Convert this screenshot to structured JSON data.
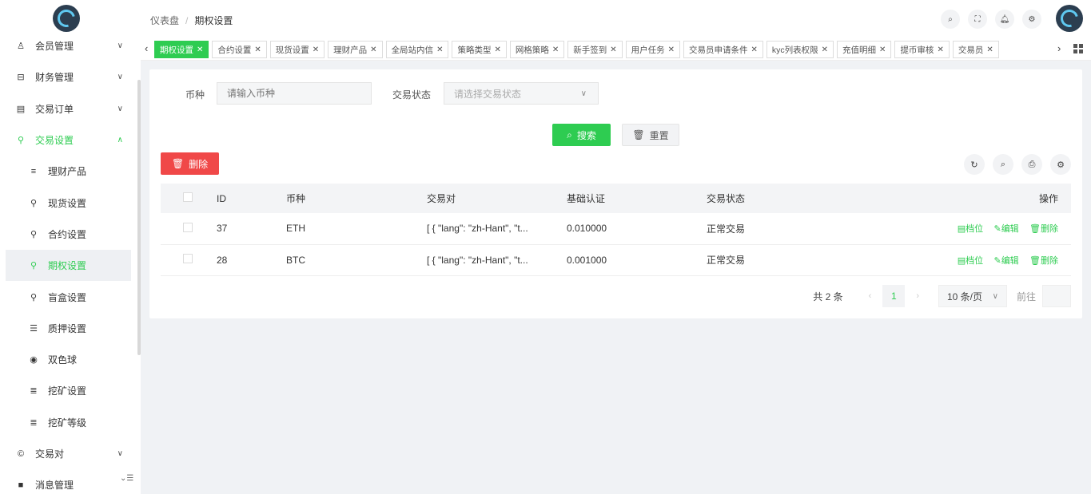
{
  "header": {
    "breadcrumb": [
      "仪表盘",
      "期权设置"
    ],
    "icons": [
      "search-icon",
      "fullscreen-icon",
      "bell-icon",
      "settings-icon"
    ]
  },
  "sidebar": {
    "items": [
      {
        "label": "会员管理",
        "icon": "user-icon",
        "chevron": "v"
      },
      {
        "label": "财务管理",
        "icon": "wallet-icon",
        "chevron": "v"
      },
      {
        "label": "交易订单",
        "icon": "order-icon",
        "chevron": "v"
      },
      {
        "label": "交易设置",
        "icon": "wrench-icon",
        "chevron": "^"
      },
      {
        "label": "理财产品",
        "icon": "list-icon"
      },
      {
        "label": "现货设置",
        "icon": "wrench-icon"
      },
      {
        "label": "合约设置",
        "icon": "wrench-icon"
      },
      {
        "label": "期权设置",
        "icon": "wrench-icon"
      },
      {
        "label": "盲盒设置",
        "icon": "wrench-icon"
      },
      {
        "label": "质押设置",
        "icon": "lines-icon"
      },
      {
        "label": "双色球",
        "icon": "target-icon"
      },
      {
        "label": "挖矿设置",
        "icon": "stack-icon"
      },
      {
        "label": "挖矿等级",
        "icon": "stack-icon"
      },
      {
        "label": "交易对",
        "icon": "copyright-icon",
        "chevron": "v"
      },
      {
        "label": "消息管理",
        "icon": "message-icon",
        "chevron": "v"
      }
    ]
  },
  "tabs": [
    {
      "label": "期权设置"
    },
    {
      "label": "合约设置"
    },
    {
      "label": "现货设置"
    },
    {
      "label": "理财产品"
    },
    {
      "label": "全局站内信"
    },
    {
      "label": "策略类型"
    },
    {
      "label": "网格策略"
    },
    {
      "label": "新手签到"
    },
    {
      "label": "用户任务"
    },
    {
      "label": "交易员申请条件"
    },
    {
      "label": "kyc列表权限"
    },
    {
      "label": "充值明细"
    },
    {
      "label": "提币审核"
    },
    {
      "label": "交易员"
    }
  ],
  "filters": {
    "coin_label": "币种",
    "coin_placeholder": "请输入币种",
    "status_label": "交易状态",
    "status_placeholder": "请选择交易状态"
  },
  "actions": {
    "search": "搜索",
    "reset": "重置",
    "delete": "删除"
  },
  "table": {
    "columns": [
      "ID",
      "币种",
      "交易对",
      "基础认证",
      "交易状态",
      "操作"
    ],
    "rows": [
      {
        "id": "37",
        "coin": "ETH",
        "pair": "[ { \"lang\": \"zh-Hant\", \"t...",
        "base": "0.010000",
        "status": "正常交易"
      },
      {
        "id": "28",
        "coin": "BTC",
        "pair": "[ { \"lang\": \"zh-Hant\", \"t...",
        "base": "0.001000",
        "status": "正常交易"
      }
    ],
    "row_actions": [
      "档位",
      "编辑",
      "删除"
    ]
  },
  "pagination": {
    "total": "共 2 条",
    "current": "1",
    "page_size": "10 条/页",
    "goto": "前往"
  },
  "colors": {
    "accent": "#2ecc51",
    "danger": "#f04848"
  }
}
